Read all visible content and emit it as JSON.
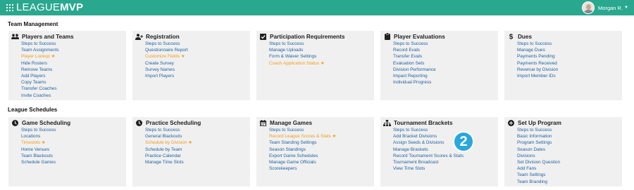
{
  "app": {
    "logo_part1": "LEAGUE",
    "logo_part2": "MVP"
  },
  "user": {
    "name": "Morgan R."
  },
  "badge": {
    "number": "2"
  },
  "sections": [
    {
      "title": "Team Management",
      "cards": [
        {
          "title": "Players and Teams",
          "icon": "users-icon",
          "links": [
            {
              "label": "Steps to Success"
            },
            {
              "label": "Team Assignments"
            },
            {
              "label": "Player Lookup",
              "highlight": true,
              "star": true
            },
            {
              "label": "Hide Rosters"
            },
            {
              "label": "Remove Teams"
            },
            {
              "label": "Add Players"
            },
            {
              "label": "Copy Teams"
            },
            {
              "label": "Transfer Coaches"
            },
            {
              "label": "Invite Coaches"
            }
          ]
        },
        {
          "title": "Registration",
          "icon": "user-plus-icon",
          "links": [
            {
              "label": "Steps to Success"
            },
            {
              "label": "Questionnaire Report"
            },
            {
              "label": "Customize Fields",
              "highlight": true,
              "star": true
            },
            {
              "label": "Create Survey"
            },
            {
              "label": "Survey Names"
            },
            {
              "label": "Import Players"
            }
          ]
        },
        {
          "title": "Participation Requirements",
          "icon": "checkbox-icon",
          "links": [
            {
              "label": "Steps to Success"
            },
            {
              "label": "Manage Uploads"
            },
            {
              "label": "Form & Waiver Settings"
            },
            {
              "label": "Coach Application Status",
              "highlight": true,
              "star": true
            }
          ]
        },
        {
          "title": "Player Evaluations",
          "icon": "clipboard-icon",
          "links": [
            {
              "label": "Steps to Success"
            },
            {
              "label": "Record Evals"
            },
            {
              "label": "Transfer Evals"
            },
            {
              "label": "Evaluation Sets"
            },
            {
              "label": "Division Performance"
            },
            {
              "label": "Impact Reporting"
            },
            {
              "label": "Individual Progress"
            }
          ]
        },
        {
          "title": "Dues",
          "icon": "dollar-icon",
          "links": [
            {
              "label": "Steps to Success"
            },
            {
              "label": "Manage Dues"
            },
            {
              "label": "Payments Pending"
            },
            {
              "label": "Payments Received"
            },
            {
              "label": "Revenue by Division"
            },
            {
              "label": "Import Member IDs"
            }
          ]
        }
      ]
    },
    {
      "title": "League Schedules",
      "cards": [
        {
          "title": "Game Scheduling",
          "icon": "clock-icon",
          "links": [
            {
              "label": "Steps to Success"
            },
            {
              "label": "Locations"
            },
            {
              "label": "Timeslots",
              "highlight": true,
              "star": true
            },
            {
              "label": "Home Venues"
            },
            {
              "label": "Team Blackouts"
            },
            {
              "label": "Schedule Games"
            }
          ]
        },
        {
          "title": "Practice Scheduling",
          "icon": "clock-icon",
          "links": [
            {
              "label": "Steps to Success"
            },
            {
              "label": "General Blackouts"
            },
            {
              "label": "Schedule by Division",
              "highlight": true,
              "star": true
            },
            {
              "label": "Schedule by Team"
            },
            {
              "label": "Practice Calendar"
            },
            {
              "label": "Manage Time Slots"
            }
          ]
        },
        {
          "title": "Manage Games",
          "icon": "calendar-icon",
          "links": [
            {
              "label": "Steps to Success"
            },
            {
              "label": "Record League Scores & Stats",
              "highlight": true,
              "star": true
            },
            {
              "label": "Team Standing Settings"
            },
            {
              "label": "Season Standings"
            },
            {
              "label": "Export Game Schedules"
            },
            {
              "label": "Manage Game Officials"
            },
            {
              "label": "Scorekeepers"
            }
          ]
        },
        {
          "title": "Tournament Brackets",
          "icon": "sitemap-icon",
          "links": [
            {
              "label": "Steps to Success"
            },
            {
              "label": "Add Bracket Divisions"
            },
            {
              "label": "Assign Seeds & Divisions"
            },
            {
              "label": "Manage Brackets"
            },
            {
              "label": "Record Tournament Scores & Stats"
            },
            {
              "label": "Tournament Broadcast"
            },
            {
              "label": "View Time Slots"
            }
          ]
        },
        {
          "title": "Set Up Program",
          "icon": "plus-circle-icon",
          "links": [
            {
              "label": "Steps to Success"
            },
            {
              "label": "Basic Information"
            },
            {
              "label": "Program Settings"
            },
            {
              "label": "Season Dates"
            },
            {
              "label": "Divisions"
            },
            {
              "label": "Set Division Question"
            },
            {
              "label": "Add Fans"
            },
            {
              "label": "Team Settings"
            },
            {
              "label": "Team Branding"
            }
          ]
        }
      ]
    }
  ]
}
